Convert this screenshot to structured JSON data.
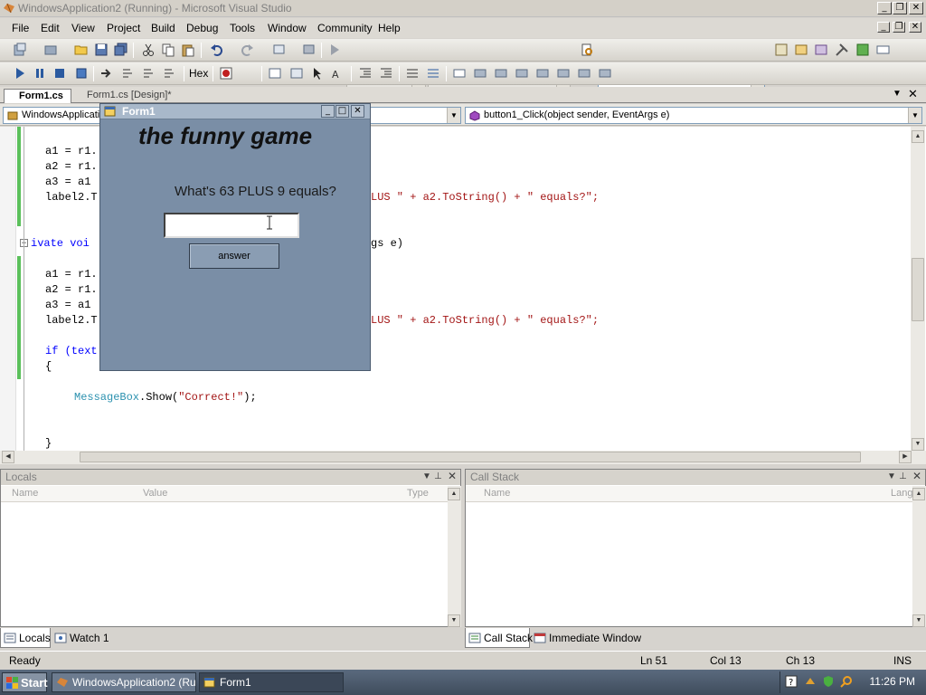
{
  "window": {
    "title": "WindowsApplication2 (Running) - Microsoft Visual Studio"
  },
  "menu": [
    "File",
    "Edit",
    "View",
    "Project",
    "Build",
    "Debug",
    "Tools",
    "Window",
    "Community",
    "Help"
  ],
  "toolbar": {
    "hex_label": "Hex"
  },
  "tabs": {
    "active": "Form1.cs",
    "inactive": "Form1.cs [Design]*"
  },
  "navbar": {
    "class_combo": "WindowsApplicatio",
    "member_combo": "button1_Click(object sender, EventArgs e)"
  },
  "code": {
    "l1": "a1 = r1.",
    "l2": "a2 = r1.",
    "l3": "a3 = a1",
    "l4a": "label2.T",
    "l4b": "LUS \" + a2.ToString() + \" equals?\";",
    "l5a": "ivate voi",
    "l5b": "gs e)",
    "l6": "a1 = r1.",
    "l7": "a2 = r1.",
    "l8": "a3 = a1",
    "l9a": "label2.T",
    "l9b": "LUS \" + a2.ToString() + \" equals?\";",
    "l10a": "if (text",
    "l11": "{",
    "l12_class": "MessageBox",
    "l12_rest": ".Show(",
    "l12_str": "\"Correct!\"",
    "l12_end": ");",
    "l13": "}"
  },
  "form1": {
    "title": "Form1",
    "game_title": "the funny game",
    "question": "What's 63 PLUS 9 equals?",
    "answer_value": "",
    "answer_button": "answer"
  },
  "locals": {
    "title": "Locals",
    "col_name": "Name",
    "col_value": "Value",
    "col_type": "Type"
  },
  "callstack": {
    "title": "Call Stack",
    "col_name": "Name",
    "col_lang": "Lang"
  },
  "bottom_tabs": {
    "locals": "Locals",
    "watch": "Watch 1",
    "callstack": "Call Stack",
    "immediate": "Immediate Window"
  },
  "status": {
    "ready": "Ready",
    "ln": "Ln 51",
    "col": "Col 13",
    "ch": "Ch 13",
    "ins": "INS"
  },
  "taskbar": {
    "start": "Start",
    "task1": "WindowsApplication2 (Ru...",
    "task2": "Form1",
    "clock": "11:26 PM"
  },
  "colors": {
    "keyword": "#0000ff",
    "class": "#2b91af",
    "string": "#a31515",
    "form_bg": "#7a8ea6"
  }
}
